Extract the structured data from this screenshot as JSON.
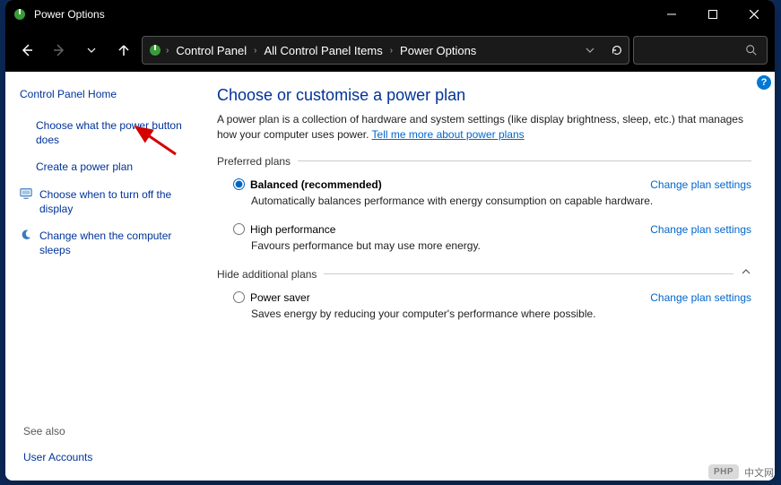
{
  "window": {
    "title": "Power Options"
  },
  "breadcrumb": {
    "segments": [
      "Control Panel",
      "All Control Panel Items",
      "Power Options"
    ]
  },
  "sidebar": {
    "home": "Control Panel Home",
    "links": [
      {
        "label": "Choose what the power button does",
        "icon": ""
      },
      {
        "label": "Create a power plan",
        "icon": ""
      },
      {
        "label": "Choose when to turn off the display",
        "icon": "monitor"
      },
      {
        "label": "Change when the computer sleeps",
        "icon": "moon"
      }
    ],
    "see_also_heading": "See also",
    "see_also_link": "User Accounts"
  },
  "main": {
    "heading": "Choose or customise a power plan",
    "description_prefix": "A power plan is a collection of hardware and system settings (like display brightness, sleep, etc.) that manages how your computer uses power. ",
    "description_link": "Tell me more about power plans",
    "preferred_heading": "Preferred plans",
    "additional_heading": "Hide additional plans",
    "change_settings_label": "Change plan settings",
    "plans_preferred": [
      {
        "name": "Balanced (recommended)",
        "desc": "Automatically balances performance with energy consumption on capable hardware.",
        "selected": true
      },
      {
        "name": "High performance",
        "desc": "Favours performance but may use more energy.",
        "selected": false
      }
    ],
    "plans_additional": [
      {
        "name": "Power saver",
        "desc": "Saves energy by reducing your computer's performance where possible.",
        "selected": false
      }
    ]
  },
  "watermark": {
    "logo": "PHP",
    "text": "中文网"
  }
}
